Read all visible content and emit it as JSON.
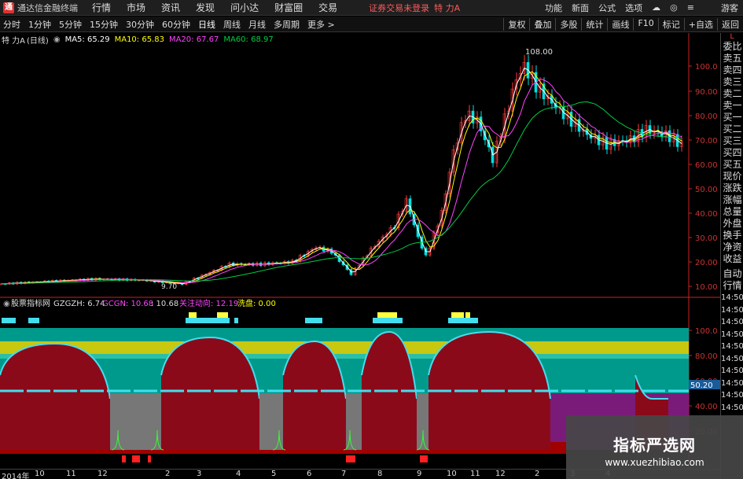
{
  "titlebar": {
    "logo_glyph": "通",
    "app_name": "通达信金融终端",
    "menus": [
      "行情",
      "市场",
      "资讯",
      "发现",
      "问小达",
      "财富圈",
      "交易"
    ],
    "alert": "证券交易未登录",
    "stock_name": "特 力A",
    "right_menus": [
      "功能",
      "新面",
      "公式",
      "选项"
    ],
    "guest": "游客"
  },
  "periodbar": {
    "periods": [
      "分时",
      "1分钟",
      "5分钟",
      "15分钟",
      "30分钟",
      "60分钟",
      "日线",
      "周线",
      "月线",
      "多周期",
      "更多 >"
    ],
    "tools": [
      "复权",
      "叠加",
      "多股",
      "统计",
      "画线",
      "F10",
      "标记",
      "+自选",
      "返回"
    ]
  },
  "main_legend": {
    "name": "特 力A",
    "period": "(日线)",
    "ma5": "MA5: 65.29",
    "ma10": "MA10: 65.83",
    "ma20": "MA20: 67.67",
    "ma60": "MA60: 68.97"
  },
  "price_axis": [
    "100.0",
    "90.00",
    "80.00",
    "70.00",
    "60.00",
    "50.00",
    "40.00",
    "30.00",
    "20.00",
    "10.00"
  ],
  "price_annotations": {
    "high": "108.00",
    "low": "9.70"
  },
  "indicator_legend": {
    "name": "股票指标网",
    "gzgzh": "GZGZH: 6.74",
    "gcgn": "GCGN: 10.68",
    "v3": ": 10.68",
    "focus": "关注动向: 12.19",
    "wash": "洗盘: 0.00"
  },
  "indicator_axis": [
    "100.0",
    "80.00",
    "60.00",
    "40.00",
    "20.00"
  ],
  "indicator_marker": "50.20",
  "right_panel": {
    "top": "L",
    "labels": [
      "委比",
      "卖五",
      "卖四",
      "卖三",
      "卖二",
      "卖一",
      "买一",
      "买二",
      "买三",
      "买四",
      "买五",
      "现价",
      "涨跌",
      "涨幅",
      "总量",
      "外盘",
      "换手",
      "净资",
      "收益"
    ],
    "bottom_labels": [
      "自动",
      "行情"
    ],
    "times": [
      "14:50",
      "14:50",
      "14:50",
      "14:50",
      "14:50",
      "14:50",
      "14:50",
      "14:50",
      "14:50",
      "14:50"
    ]
  },
  "date_axis": [
    "2014年",
    "10",
    "11",
    "12",
    "2",
    "3",
    "4",
    "5",
    "6",
    "7",
    "8",
    "9",
    "10",
    "11",
    "12",
    "2",
    "3",
    "4"
  ],
  "watermark": {
    "title": "指标严选网",
    "url": "www.xuezhibiao.com"
  },
  "colors": {
    "up": "#ff3b3b",
    "down": "#00e0e0",
    "ma5": "#ffffff",
    "ma10": "#ffff00",
    "ma20": "#ff44ff",
    "ma60": "#00cc44"
  }
}
